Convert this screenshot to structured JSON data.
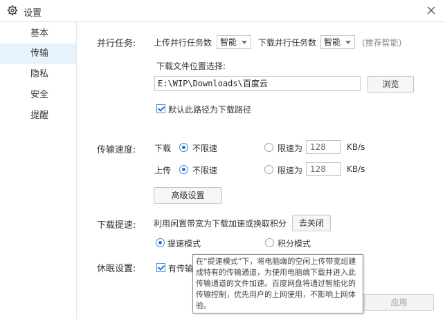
{
  "window": {
    "title": "设置"
  },
  "sidebar": {
    "items": [
      {
        "label": "基本"
      },
      {
        "label": "传输",
        "active": true
      },
      {
        "label": "隐私"
      },
      {
        "label": "安全"
      },
      {
        "label": "提醒"
      }
    ]
  },
  "parallel": {
    "label": "并行任务:",
    "upload_label": "上传并行任务数",
    "upload_value": "智能",
    "download_label": "下载并行任务数",
    "download_value": "智能",
    "hint": "(推荐智能)"
  },
  "location": {
    "label": "下载文件位置选择:",
    "path": "E:\\WIP\\Downloads\\百度云",
    "browse": "浏览",
    "default_checkbox": "默认此路径为下载路径",
    "default_checked": true
  },
  "speed": {
    "label": "传输速度:",
    "download_label": "下载",
    "upload_label": "上传",
    "unlimited": "不限速",
    "limited": "限速为",
    "download_limit": "128",
    "upload_limit": "128",
    "unit": "KB/s",
    "advanced": "高级设置"
  },
  "boost": {
    "label": "下载提速:",
    "description": "利用闲置带宽为下载加速或换取积分",
    "close_button": "去关闭",
    "mode_speed": "提速模式",
    "mode_points": "积分模式"
  },
  "sleep": {
    "label": "休眠设置:",
    "checkbox_partial": "有传输"
  },
  "tooltip": {
    "text": "在“提速模式”下，将电脑端的空闲上传带宽组建成特有的传输通道，为使用电脑端下载并进入此传输通道的文件加速。百度网盘将通过智能化的传输控制，优先用户的上网使用，不影响上网体验。"
  },
  "footer": {
    "apply": "应用"
  }
}
